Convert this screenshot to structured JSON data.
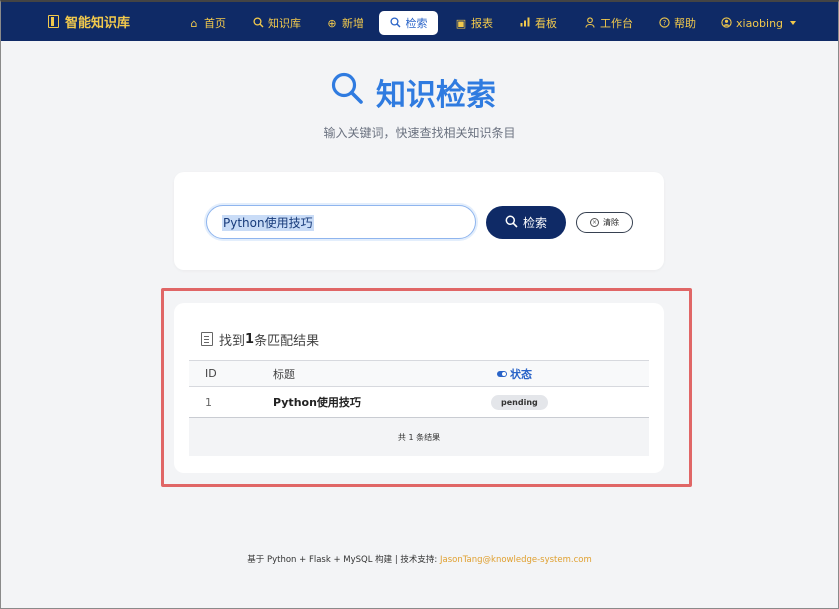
{
  "nav": {
    "brand": "智能知识库",
    "items": [
      {
        "label": "首页",
        "icon": "home-icon"
      },
      {
        "label": "知识库",
        "icon": "search-icon"
      },
      {
        "label": "新增",
        "icon": "plus-circle-icon"
      },
      {
        "label": "检索",
        "icon": "search-icon",
        "active": true
      },
      {
        "label": "报表",
        "icon": "report-icon"
      },
      {
        "label": "看板",
        "icon": "bar-chart-icon"
      },
      {
        "label": "工作台",
        "icon": "user-icon"
      },
      {
        "label": "帮助",
        "icon": "help-icon"
      }
    ],
    "user": "xiaobing"
  },
  "hero": {
    "title": "知识检索",
    "subtitle": "输入关键词，快速查找相关知识条目"
  },
  "search": {
    "value": "Python使用技巧",
    "button": "检索",
    "clear": "清除"
  },
  "results": {
    "prefix": "找到",
    "count": "1",
    "suffix": "条匹配结果",
    "columns": [
      "ID",
      "标题",
      "状态"
    ],
    "rows": [
      {
        "id": "1",
        "title": "Python使用技巧",
        "status": "pending"
      }
    ],
    "footer": "共 1 条结果"
  },
  "footer": {
    "text": "基于 Python + Flask + MySQL 构建 | 技术支持:",
    "email": "JasonTang@knowledge-system.com"
  },
  "colors": {
    "navbar": "#0f2a66",
    "nav_text": "#f2c94c",
    "accent": "#2f7be0",
    "highlight": "#e06666"
  }
}
